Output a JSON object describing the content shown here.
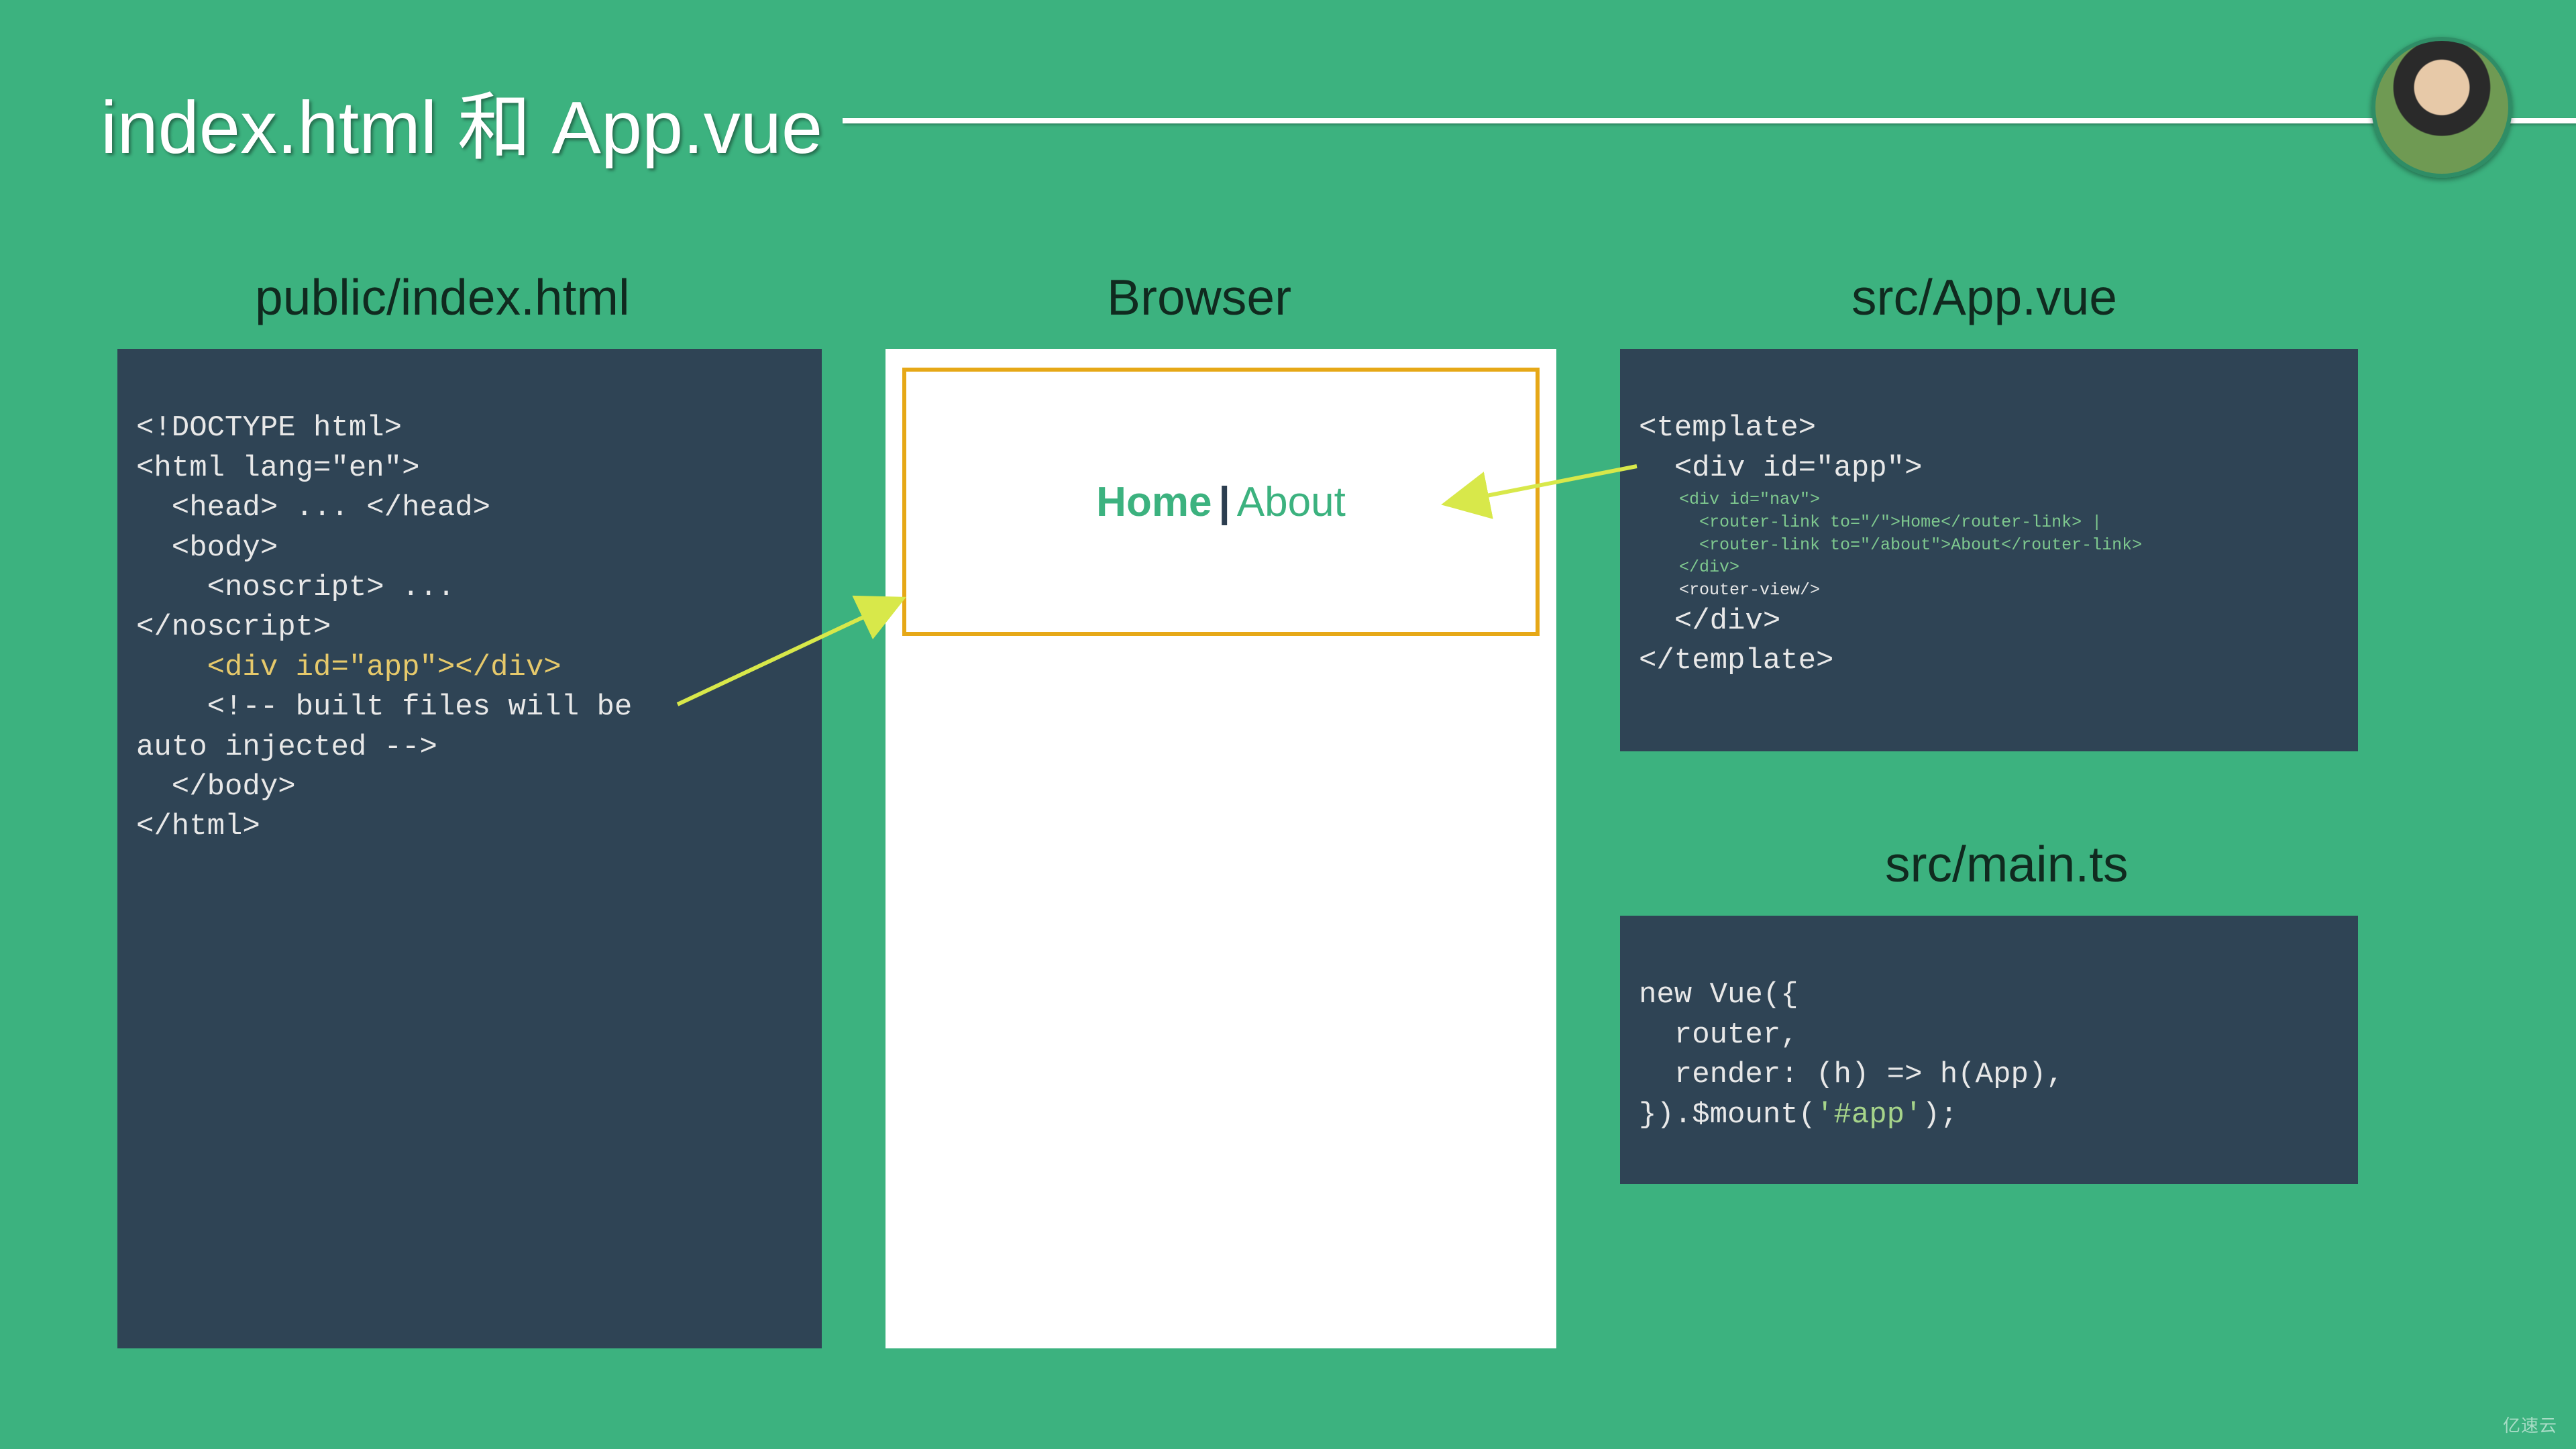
{
  "slide": {
    "title": "index.html 和 App.vue"
  },
  "columns": {
    "left_title": "public/index.html",
    "mid_title": "Browser",
    "right_title1": "src/App.vue",
    "right_title2": "src/main.ts"
  },
  "code": {
    "index_html": {
      "l1": "<!DOCTYPE html>",
      "l2": "<html lang=\"en\">",
      "l3": "  <head> ... </head>",
      "l4": "  <body>",
      "l5": "    <noscript> ...",
      "l6": "</noscript>",
      "l7": "    <div id=\"app\"></div>",
      "l8": "    <!-- built files will be",
      "l9": "auto injected -->",
      "l10": "  </body>",
      "l11": "</html>"
    },
    "app_vue": {
      "l1": "<template>",
      "l2": "  <div id=\"app\">",
      "nav1": "    <div id=\"nav\">",
      "nav2": "      <router-link to=\"/\">Home</router-link> |",
      "nav3": "      <router-link to=\"/about\">About</router-link>",
      "nav4": "    </div>",
      "rv": "    <router-view/>",
      "l3": "  </div>",
      "l4": "</template>"
    },
    "main_ts": {
      "l1": "new Vue({",
      "l2": "  router,",
      "l3": "  render: (h) => h(App),",
      "l4a": "}).$mount(",
      "l4b": "'#app'",
      "l4c": ");"
    }
  },
  "browser": {
    "home": "Home",
    "sep": " | ",
    "about": "About"
  },
  "watermark": "亿速云"
}
